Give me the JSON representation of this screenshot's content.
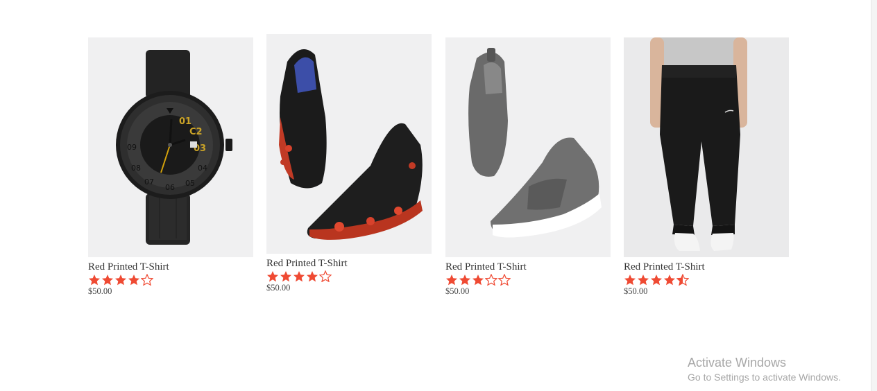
{
  "accent_color": "#ef4a33",
  "products": [
    {
      "name": "Red Printed T-Shirt",
      "price": "$50.00",
      "rating": 4,
      "image": "wristwatch-image"
    },
    {
      "name": "Red Printed T-Shirt",
      "price": "$50.00",
      "rating": 4,
      "image": "sneakers-image"
    },
    {
      "name": "Red Printed T-Shirt",
      "price": "$50.00",
      "rating": 3,
      "image": "slip-on-shoes-image"
    },
    {
      "name": "Red Printed T-Shirt",
      "price": "$50.00",
      "rating": 4.5,
      "image": "joggers-image"
    }
  ],
  "watermark": {
    "title": "Activate Windows",
    "subtitle": "Go to Settings to activate Windows."
  }
}
